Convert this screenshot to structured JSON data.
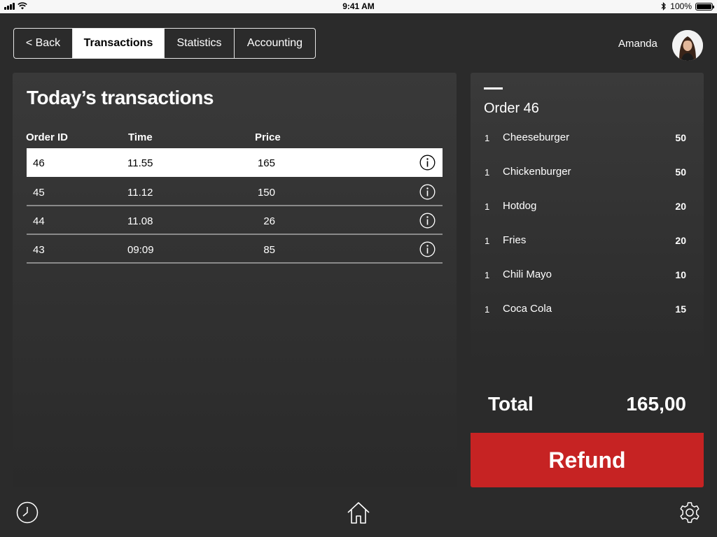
{
  "status_bar": {
    "time": "9:41 AM",
    "battery": "100%"
  },
  "nav": {
    "back": "< Back",
    "tabs": [
      {
        "label": "Transactions",
        "active": true
      },
      {
        "label": "Statistics",
        "active": false
      },
      {
        "label": "Accounting",
        "active": false
      }
    ]
  },
  "user": {
    "name": "Amanda"
  },
  "transactions": {
    "title": "Today’s transactions",
    "columns": {
      "id": "Order ID",
      "time": "Time",
      "price": "Price"
    },
    "rows": [
      {
        "id": "46",
        "time": "11.55",
        "price": "165",
        "selected": true
      },
      {
        "id": "45",
        "time": "11.12",
        "price": "150",
        "selected": false
      },
      {
        "id": "44",
        "time": "11.08",
        "price": "26",
        "selected": false
      },
      {
        "id": "43",
        "time": "09:09",
        "price": "85",
        "selected": false
      }
    ]
  },
  "order": {
    "title": "Order 46",
    "items": [
      {
        "qty": "1",
        "name": "Cheeseburger",
        "price": "50"
      },
      {
        "qty": "1",
        "name": "Chickenburger",
        "price": "50"
      },
      {
        "qty": "1",
        "name": "Hotdog",
        "price": "20"
      },
      {
        "qty": "1",
        "name": "Fries",
        "price": "20"
      },
      {
        "qty": "1",
        "name": "Chili Mayo",
        "price": "10"
      },
      {
        "qty": "1",
        "name": "Coca Cola",
        "price": "15"
      }
    ],
    "total_label": "Total",
    "total_value": "165,00",
    "refund_label": "Refund"
  },
  "icons": {
    "clock": "clock-icon",
    "home": "home-icon",
    "settings": "gear-icon",
    "info": "info-icon"
  },
  "colors": {
    "background": "#2b2b2b",
    "refund": "#c62323",
    "selected_row": "#ffffff"
  }
}
